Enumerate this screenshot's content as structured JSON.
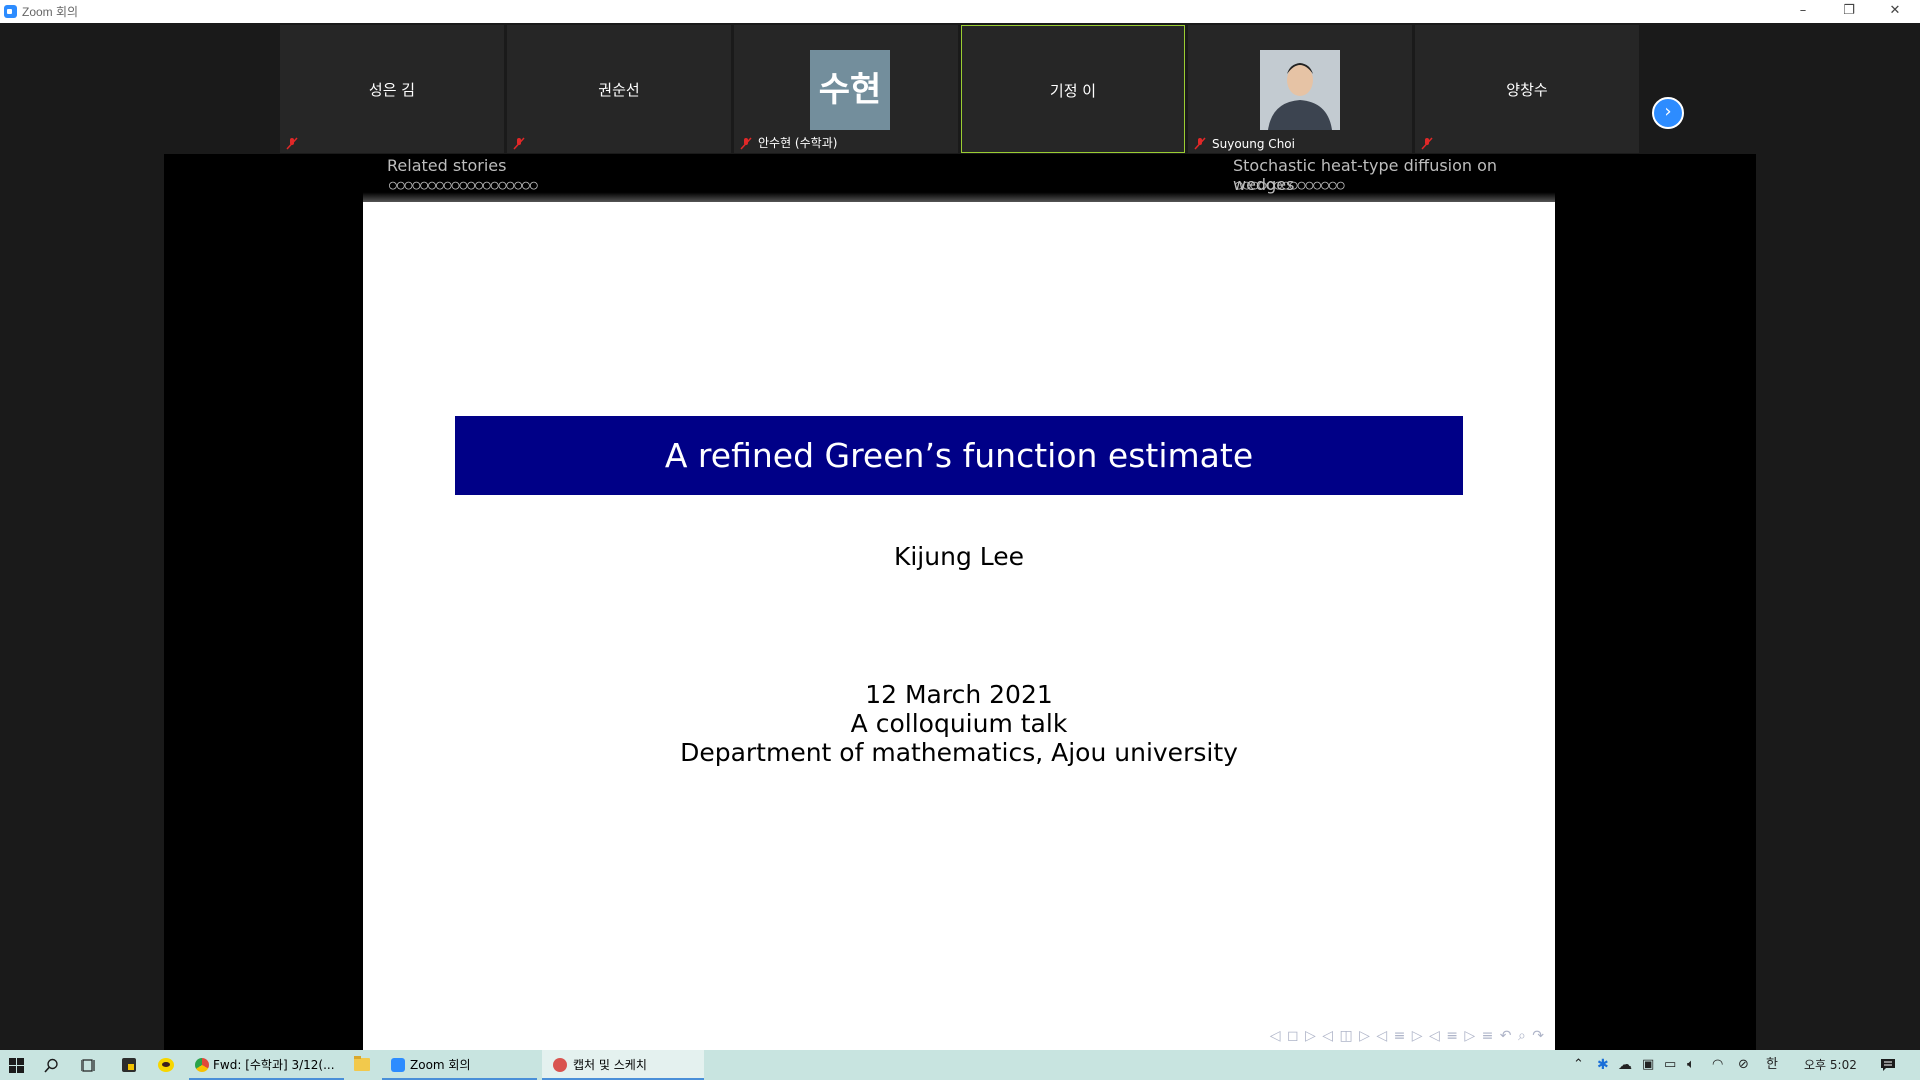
{
  "window": {
    "title": "Zoom 회의",
    "minimize": "–",
    "restore": "❐",
    "close": "✕"
  },
  "participants": [
    {
      "name": "성은 김",
      "label": ""
    },
    {
      "name": "권순선",
      "label": ""
    },
    {
      "name": "",
      "label": "안수현 (수학과)",
      "avatar_text": "수현"
    },
    {
      "name": "기정 이",
      "label": "",
      "active": true
    },
    {
      "name": "",
      "label": "Suyoung Choi"
    },
    {
      "name": "양창수",
      "label": ""
    }
  ],
  "next_button": "›",
  "slide": {
    "header_left": "Related stories",
    "header_left_dots": "○○○○○○○○○○○○○○○○○○○",
    "header_right": "Stochastic heat-type diffusion on wedges",
    "header_right_dots": "○○○○○○○○○○○○○○",
    "title": "A refined Green’s function estimate",
    "author": "Kijung Lee",
    "date": "12 March 2021",
    "event": "A colloquium talk",
    "affiliation": "Department of mathematics, Ajou university",
    "nav_symbols": "◁ ◻ ▷   ◁ ◫ ▷   ◁ ≡ ▷   ◁ ≡ ▷   ≡   ↶ ⌕ ↷"
  },
  "taskbar": {
    "apps": [
      {
        "label": "Fwd: [수학과] 3/12(...",
        "icon_color": "#e0483b"
      },
      {
        "label": "Zoom 회의",
        "icon_color": "#2d8cff"
      },
      {
        "label": "캡처 및 스케치",
        "icon_color": "#d9534f"
      }
    ],
    "clock": "오후 5:02",
    "ime": "한",
    "tray_chevron": "⌃"
  },
  "colors": {
    "accent": "#2d8cff",
    "slide_title_bg": "#000087",
    "active_border": "#9acd32",
    "taskbar_bg": "#c8e4e0"
  }
}
